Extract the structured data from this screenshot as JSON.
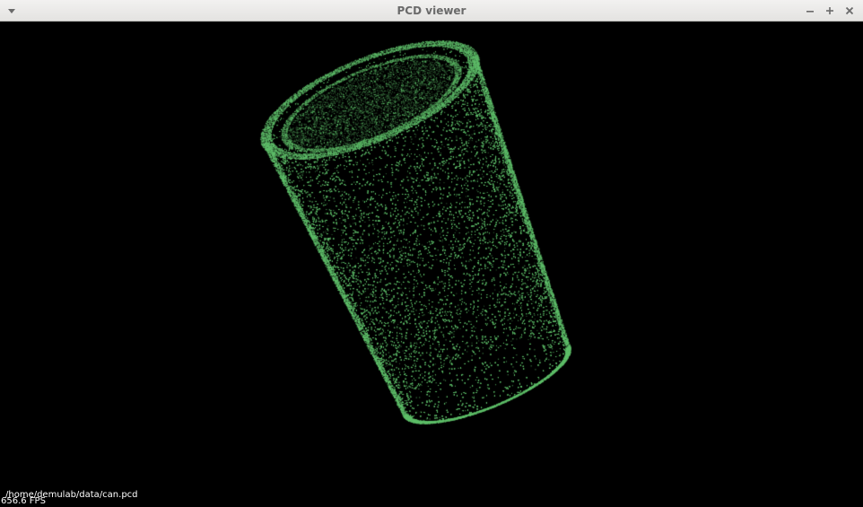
{
  "window": {
    "title": "PCD viewer"
  },
  "icons": {
    "menu": "chevron-down-icon",
    "minimize": "minimize-icon",
    "maximize": "plus-icon",
    "close": "close-icon"
  },
  "viewer": {
    "background_color": "#000000",
    "point_color": "#5fbf6a",
    "file_path": "/home/demulab/data/can.pcd",
    "fps": "656.6 FPS"
  }
}
